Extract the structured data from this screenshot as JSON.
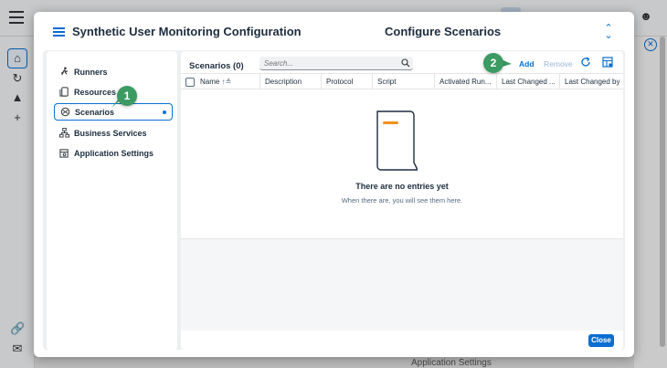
{
  "dialog": {
    "title": "Synthetic User Monitoring Configuration",
    "subtitle": "Configure Scenarios",
    "close_label": "Close"
  },
  "sidebar": {
    "items": [
      {
        "label": "Runners",
        "icon": "runner-icon"
      },
      {
        "label": "Resources",
        "icon": "resources-icon"
      },
      {
        "label": "Scenarios",
        "icon": "scenarios-icon",
        "selected": true
      },
      {
        "label": "Business Services",
        "icon": "hierarchy-icon"
      },
      {
        "label": "Application Settings",
        "icon": "app-settings-icon"
      }
    ]
  },
  "table": {
    "title": "Scenarios  (0)",
    "search_placeholder": "Search...",
    "add_label": "Add",
    "remove_label": "Remove",
    "columns": [
      "Name",
      "Description",
      "Protocol",
      "Script",
      "Activated Run...",
      "Last Changed ...",
      "Last Changed by"
    ],
    "sort_indicator": "↑≗"
  },
  "empty_state": {
    "title": "There are no entries yet",
    "subtitle": "When there are, you will see them here."
  },
  "callouts": [
    "1",
    "2"
  ],
  "background": {
    "bottom_text": "Application Settings"
  },
  "colors": {
    "accent": "#0a6ed1",
    "callout": "#3c9a63",
    "illustration_accent": "#f0901e"
  }
}
